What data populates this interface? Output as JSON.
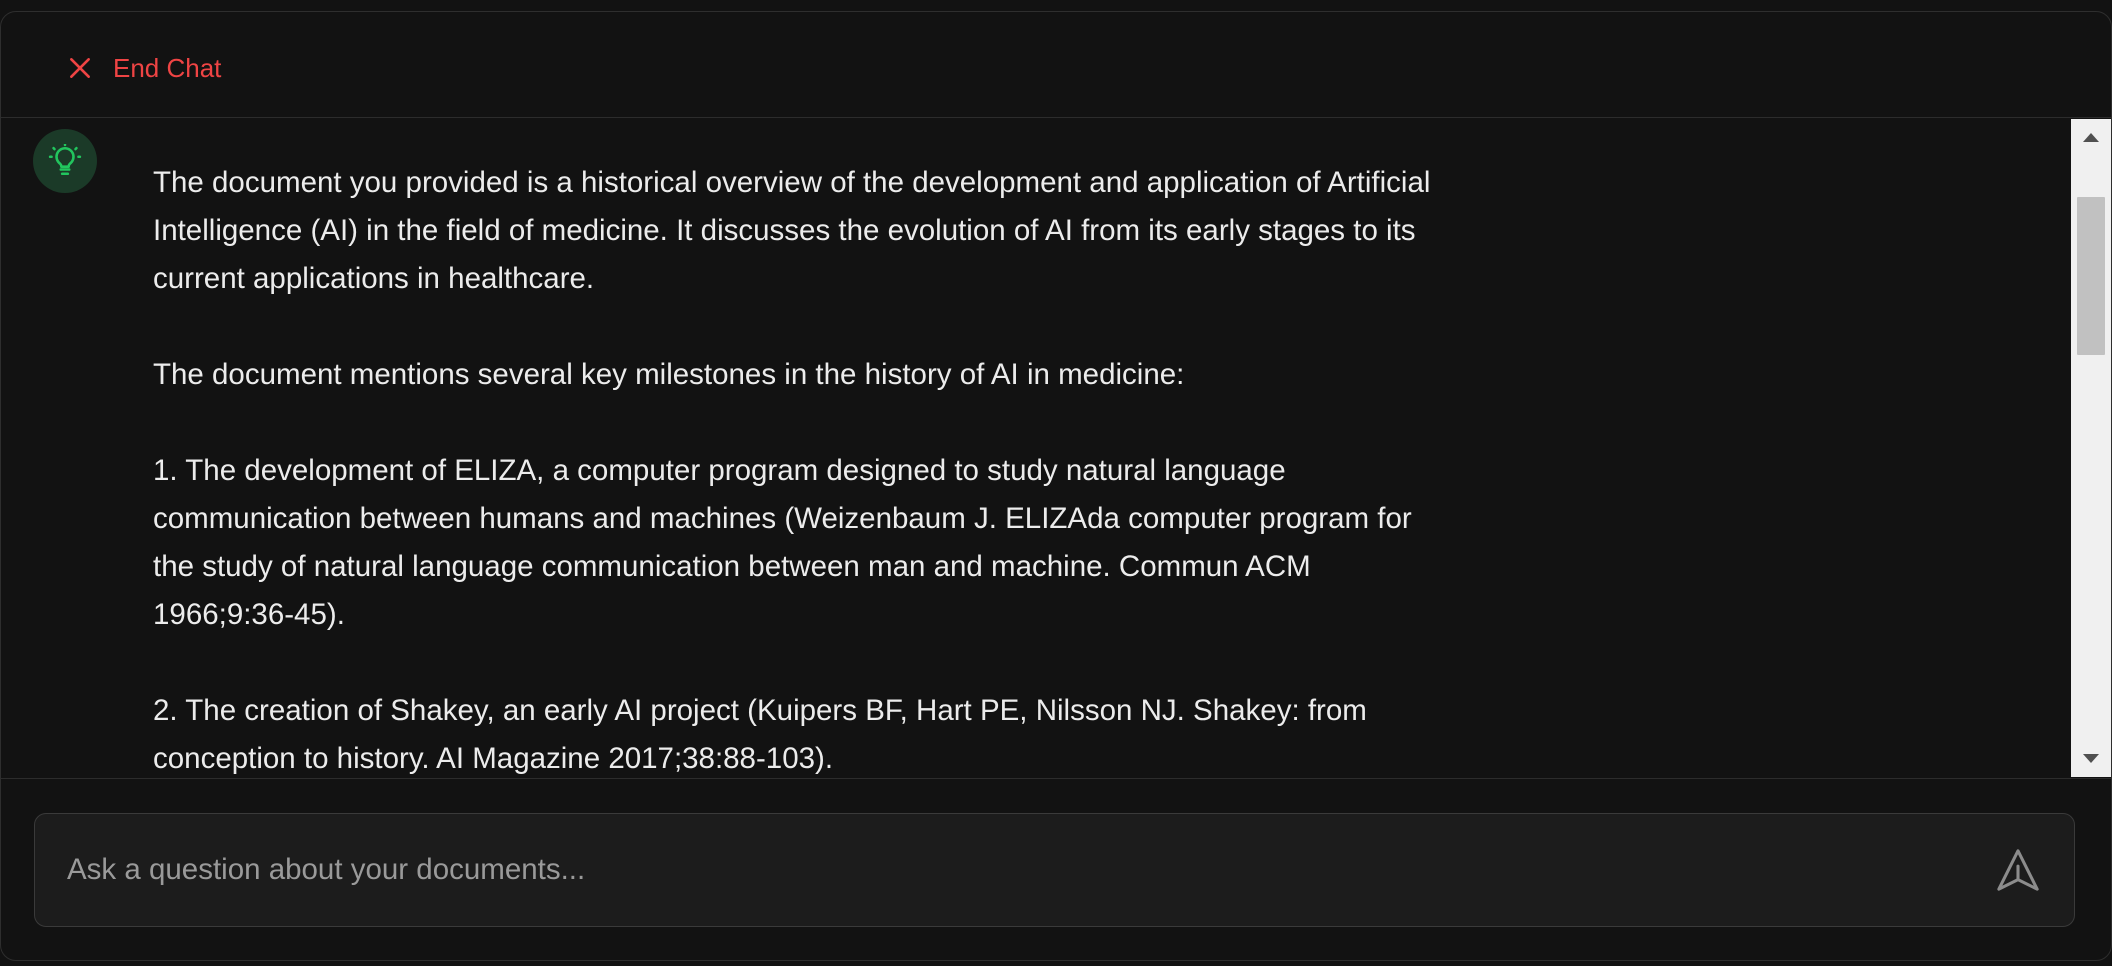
{
  "header": {
    "end_chat_label": "End Chat",
    "end_chat_icon": "close-icon"
  },
  "messages": [
    {
      "role": "assistant",
      "avatar_icon": "lightbulb-icon",
      "paragraphs": [
        "The document you provided is a historical overview of the development and application of Artificial Intelligence (AI) in the field of medicine. It discusses the evolution of AI from its early stages to its current applications in healthcare.",
        "The document mentions several key milestones in the history of AI in medicine:",
        "1. The development of ELIZA, a computer program designed to study natural language communication between humans and machines (Weizenbaum J. ELIZAda computer program for the study of natural language communication between man and machine. Commun ACM 1966;9:36-45).",
        "2. The creation of Shakey, an early AI project (Kuipers BF, Hart PE, Nilsson NJ. Shakey: from conception to history. AI Magazine 2017;38:88-103)."
      ]
    }
  ],
  "composer": {
    "placeholder": "Ask a question about your documents...",
    "value": "",
    "send_icon": "send-icon"
  },
  "colors": {
    "background": "#121212",
    "danger": "#ef4444",
    "accent_green": "#22c55e",
    "avatar_bg": "#1b3a28",
    "text": "#ececec",
    "placeholder": "#9a9a9a"
  }
}
